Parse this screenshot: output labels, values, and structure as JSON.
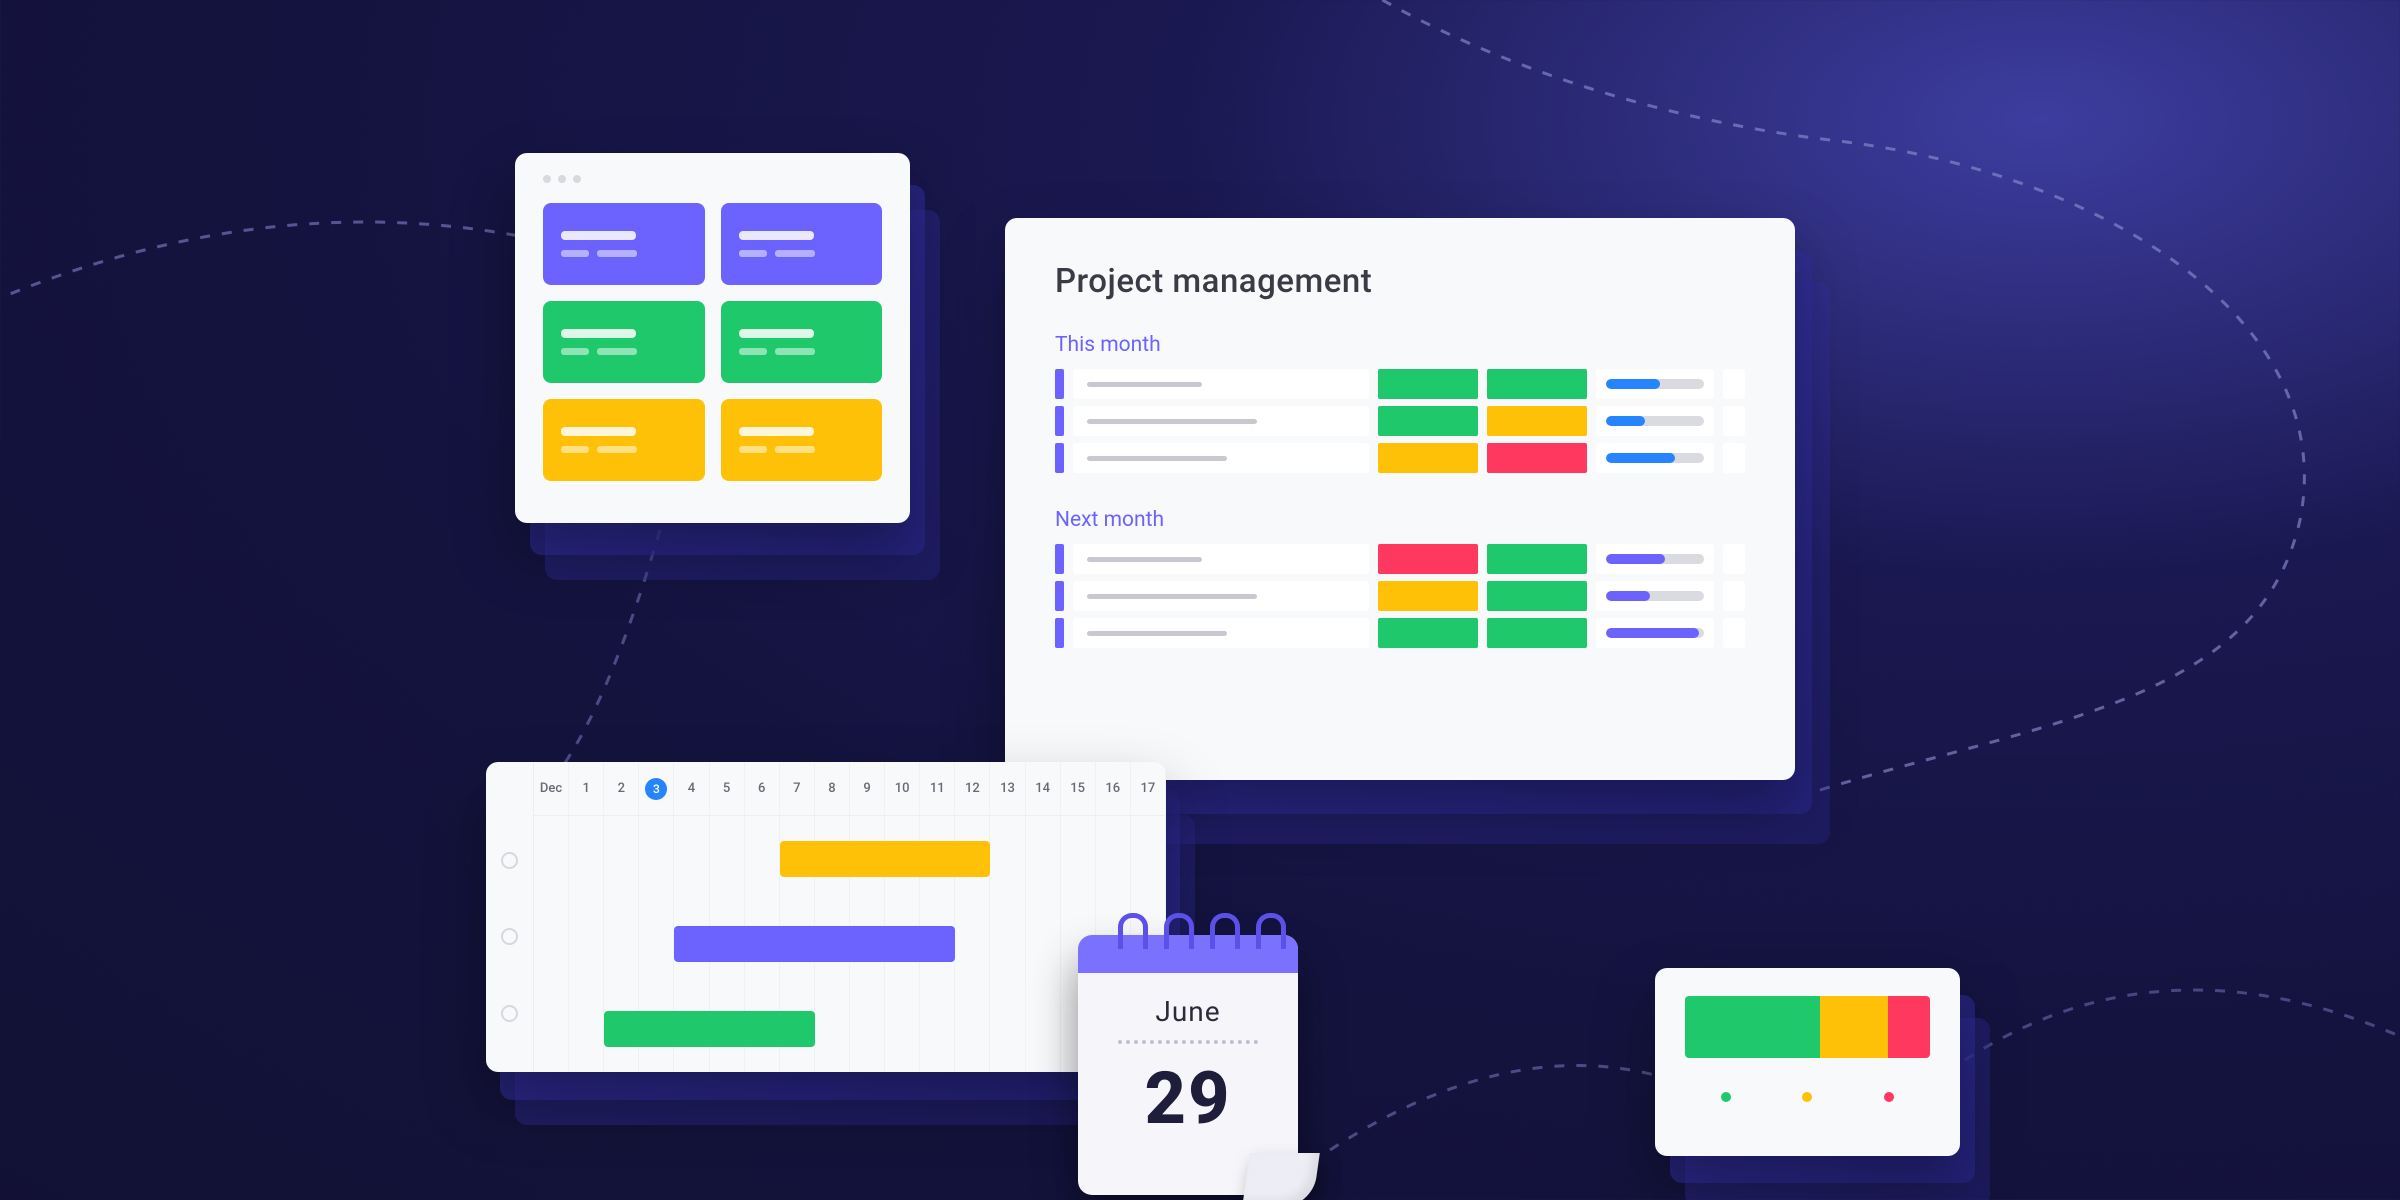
{
  "colors": {
    "purple": "#6c63ff",
    "green": "#1fc86a",
    "yellow": "#ffc107",
    "red": "#ff3860",
    "blue": "#2684ff"
  },
  "kanban": {
    "tiles": [
      {
        "color": "purple"
      },
      {
        "color": "purple"
      },
      {
        "color": "green"
      },
      {
        "color": "green"
      },
      {
        "color": "yellow"
      },
      {
        "color": "yellow"
      }
    ]
  },
  "project_panel": {
    "title": "Project management",
    "sections": [
      {
        "label": "This month",
        "rows": [
          {
            "name_width": 115,
            "status1": "green",
            "status2": "green",
            "progress": 55,
            "bar_color": "blue"
          },
          {
            "name_width": 170,
            "status1": "green",
            "status2": "yellow",
            "progress": 40,
            "bar_color": "blue"
          },
          {
            "name_width": 140,
            "status1": "yellow",
            "status2": "red",
            "progress": 70,
            "bar_color": "blue"
          }
        ]
      },
      {
        "label": "Next month",
        "rows": [
          {
            "name_width": 115,
            "status1": "red",
            "status2": "green",
            "progress": 60,
            "bar_color": "purple"
          },
          {
            "name_width": 170,
            "status1": "yellow",
            "status2": "green",
            "progress": 45,
            "bar_color": "purple"
          },
          {
            "name_width": 140,
            "status1": "green",
            "status2": "green",
            "progress": 95,
            "bar_color": "purple"
          }
        ]
      }
    ]
  },
  "gantt": {
    "month_label": "Dec",
    "days": [
      "1",
      "2",
      "3",
      "4",
      "5",
      "6",
      "7",
      "8",
      "9",
      "10",
      "11",
      "12",
      "13",
      "14",
      "15",
      "16",
      "17"
    ],
    "selected_day": "3",
    "bars": [
      {
        "row": 0,
        "start": 7,
        "span": 6,
        "color": "yellow"
      },
      {
        "row": 1,
        "start": 4,
        "span": 8,
        "color": "purple"
      },
      {
        "row": 2,
        "start": 2,
        "span": 6,
        "color": "green"
      }
    ]
  },
  "calendar": {
    "month": "June",
    "day": "29"
  },
  "status_widget": {
    "segments": [
      {
        "color": "green",
        "pct": 55
      },
      {
        "color": "yellow",
        "pct": 28
      },
      {
        "color": "red",
        "pct": 17
      }
    ],
    "legend": [
      "green",
      "yellow",
      "red"
    ]
  }
}
